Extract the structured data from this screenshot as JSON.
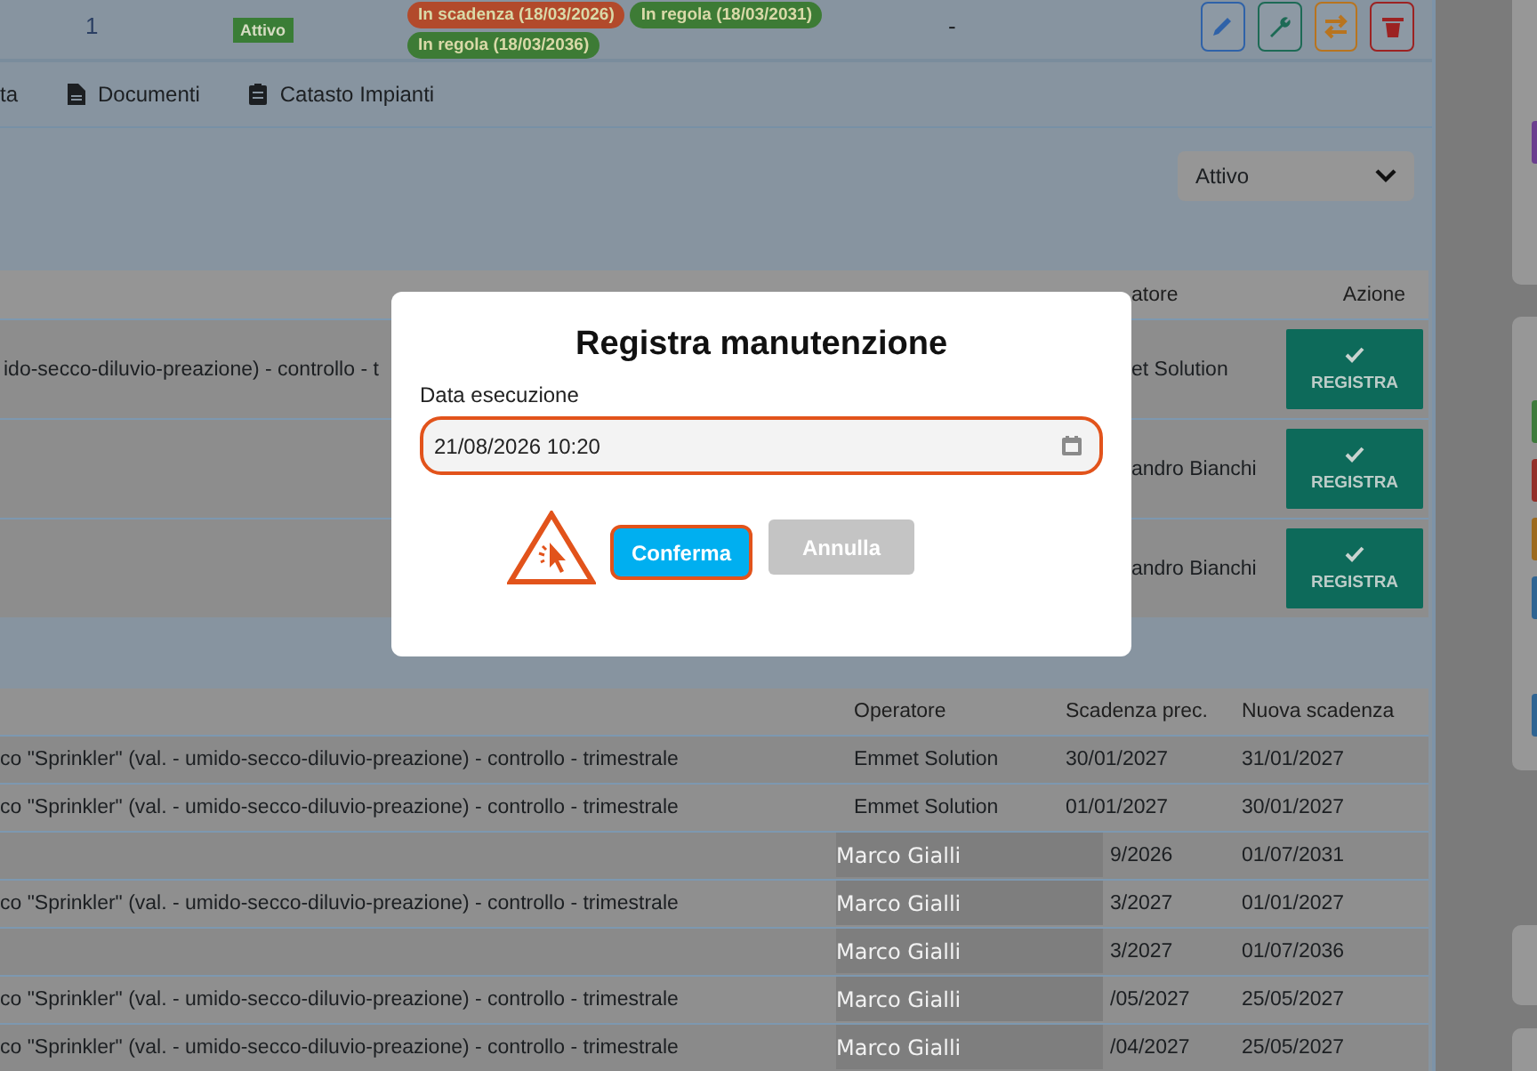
{
  "top_row": {
    "index": "1",
    "status": "Attivo",
    "badges": [
      {
        "label": "In scadenza (18/03/2026)",
        "color": "#b24a2b"
      },
      {
        "label": "In regola (18/03/2031)",
        "color": "#3d7b35"
      },
      {
        "label": "In regola (18/03/2036)",
        "color": "#3d7b35"
      }
    ],
    "last": "-",
    "actions": [
      {
        "kind": "edit"
      },
      {
        "kind": "maintenance"
      },
      {
        "kind": "transfer"
      },
      {
        "kind": "delete"
      }
    ]
  },
  "tabs": [
    {
      "label": "ta"
    },
    {
      "label": "Documenti"
    },
    {
      "label": "Catasto Impianti"
    }
  ],
  "filter": {
    "value": "Attivo"
  },
  "table_1": {
    "columns": [
      "atore",
      "Azione"
    ],
    "rows": [
      {
        "description": "ido-secco-diluvio-preazione) - controllo - t",
        "operator": "et Solution",
        "action": "REGISTRA"
      },
      {
        "operator": "andro Bianchi",
        "action": "REGISTRA"
      },
      {
        "operator": "andro Bianchi",
        "action": "REGISTRA"
      }
    ]
  },
  "table_2": {
    "columns": [
      "Operatore",
      "Scadenza prec.",
      "Nuova scadenza"
    ],
    "rows": [
      {
        "kind": "plain",
        "description": "co \"Sprinkler\" (val. - umido-secco-diluvio-preazione) - controllo - trimestrale",
        "operator": "Emmet Solution",
        "previous": "30/01/2027",
        "next": "31/01/2027"
      },
      {
        "kind": "plain",
        "description": "co \"Sprinkler\" (val. - umido-secco-diluvio-preazione) - controllo - trimestrale",
        "operator": "Emmet Solution",
        "previous": "01/01/2027",
        "next": "30/01/2027"
      },
      {
        "kind": "masked",
        "operator": "Marco Gialli",
        "previous": "9/2026",
        "next": "01/07/2031"
      },
      {
        "kind": "masked",
        "description": "co \"Sprinkler\" (val. - umido-secco-diluvio-preazione) - controllo - trimestrale",
        "operator": "Marco Gialli",
        "previous": "3/2027",
        "next": "01/01/2027"
      },
      {
        "kind": "masked",
        "operator": "Marco Gialli",
        "previous": "3/2027",
        "next": "01/07/2036"
      },
      {
        "kind": "masked",
        "description": "co \"Sprinkler\" (val. - umido-secco-diluvio-preazione) - controllo - trimestrale",
        "operator": "Marco Gialli",
        "previous": "/05/2027",
        "next": "25/05/2027"
      },
      {
        "kind": "masked",
        "description": "co \"Sprinkler\" (val. - umido-secco-diluvio-preazione) - controllo - trimestrale",
        "operator": "Marco Gialli",
        "previous": "/04/2027",
        "next": "25/05/2027"
      }
    ]
  },
  "dialog": {
    "title": "Registra manutenzione",
    "field_label": "Data esecuzione",
    "value": "21/08/2026 10:20",
    "buttons": [
      {
        "label": "Conferma",
        "kind": "primary"
      },
      {
        "label": "Annulla",
        "kind": "secondary"
      }
    ]
  },
  "sidebar": {
    "strips": [
      {
        "color": "#6b3f8f"
      },
      {
        "color": "#3f7a3c"
      },
      {
        "color": "#93302a"
      },
      {
        "color": "#9c6a1e"
      },
      {
        "color": "#2f6492"
      },
      {
        "color": "#2f6492"
      }
    ]
  }
}
